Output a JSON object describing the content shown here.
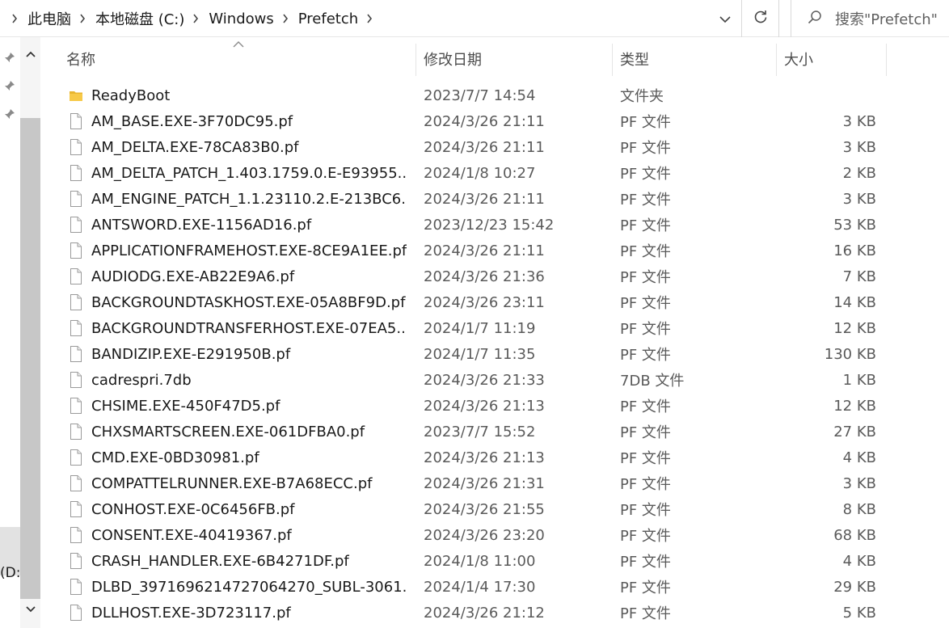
{
  "breadcrumb": {
    "items": [
      "此电脑",
      "本地磁盘 (C:)",
      "Windows",
      "Prefetch"
    ]
  },
  "search": {
    "placeholder": "搜索\"Prefetch\""
  },
  "nav": {
    "drive_label": "(D:)"
  },
  "columns": {
    "name": "名称",
    "date": "修改日期",
    "type": "类型",
    "size": "大小"
  },
  "files": [
    {
      "name": "ReadyBoot",
      "date": "2023/7/7 14:54",
      "type": "文件夹",
      "size": "",
      "icon": "folder-icon"
    },
    {
      "name": "AM_BASE.EXE-3F70DC95.pf",
      "date": "2024/3/26 21:11",
      "type": "PF 文件",
      "size": "3 KB",
      "icon": "file-icon"
    },
    {
      "name": "AM_DELTA.EXE-78CA83B0.pf",
      "date": "2024/3/26 21:11",
      "type": "PF 文件",
      "size": "3 KB",
      "icon": "file-icon"
    },
    {
      "name": "AM_DELTA_PATCH_1.403.1759.0.E-E93955...",
      "date": "2024/1/8 10:27",
      "type": "PF 文件",
      "size": "2 KB",
      "icon": "file-icon"
    },
    {
      "name": "AM_ENGINE_PATCH_1.1.23110.2.E-213BC6...",
      "date": "2024/3/26 21:11",
      "type": "PF 文件",
      "size": "3 KB",
      "icon": "file-icon"
    },
    {
      "name": "ANTSWORD.EXE-1156AD16.pf",
      "date": "2023/12/23 15:42",
      "type": "PF 文件",
      "size": "53 KB",
      "icon": "file-icon"
    },
    {
      "name": "APPLICATIONFRAMEHOST.EXE-8CE9A1EE.pf",
      "date": "2024/3/26 21:11",
      "type": "PF 文件",
      "size": "16 KB",
      "icon": "file-icon"
    },
    {
      "name": "AUDIODG.EXE-AB22E9A6.pf",
      "date": "2024/3/26 21:36",
      "type": "PF 文件",
      "size": "7 KB",
      "icon": "file-icon"
    },
    {
      "name": "BACKGROUNDTASKHOST.EXE-05A8BF9D.pf",
      "date": "2024/3/26 23:11",
      "type": "PF 文件",
      "size": "14 KB",
      "icon": "file-icon"
    },
    {
      "name": "BACKGROUNDTRANSFERHOST.EXE-07EA5...",
      "date": "2024/1/7 11:19",
      "type": "PF 文件",
      "size": "12 KB",
      "icon": "file-icon"
    },
    {
      "name": "BANDIZIP.EXE-E291950B.pf",
      "date": "2024/1/7 11:35",
      "type": "PF 文件",
      "size": "130 KB",
      "icon": "file-icon"
    },
    {
      "name": "cadrespri.7db",
      "date": "2024/3/26 21:33",
      "type": "7DB 文件",
      "size": "1 KB",
      "icon": "file-icon"
    },
    {
      "name": "CHSIME.EXE-450F47D5.pf",
      "date": "2024/3/26 21:13",
      "type": "PF 文件",
      "size": "12 KB",
      "icon": "file-icon"
    },
    {
      "name": "CHXSMARTSCREEN.EXE-061DFBA0.pf",
      "date": "2023/7/7 15:52",
      "type": "PF 文件",
      "size": "27 KB",
      "icon": "file-icon"
    },
    {
      "name": "CMD.EXE-0BD30981.pf",
      "date": "2024/3/26 21:13",
      "type": "PF 文件",
      "size": "4 KB",
      "icon": "file-icon"
    },
    {
      "name": "COMPATTELRUNNER.EXE-B7A68ECC.pf",
      "date": "2024/3/26 21:31",
      "type": "PF 文件",
      "size": "3 KB",
      "icon": "file-icon"
    },
    {
      "name": "CONHOST.EXE-0C6456FB.pf",
      "date": "2024/3/26 21:55",
      "type": "PF 文件",
      "size": "8 KB",
      "icon": "file-icon"
    },
    {
      "name": "CONSENT.EXE-40419367.pf",
      "date": "2024/3/26 23:20",
      "type": "PF 文件",
      "size": "68 KB",
      "icon": "file-icon"
    },
    {
      "name": "CRASH_HANDLER.EXE-6B4271DF.pf",
      "date": "2024/1/8 11:00",
      "type": "PF 文件",
      "size": "4 KB",
      "icon": "file-icon"
    },
    {
      "name": "DLBD_3971696214727064270_SUBL-3061...",
      "date": "2024/1/4 17:30",
      "type": "PF 文件",
      "size": "29 KB",
      "icon": "file-icon"
    },
    {
      "name": "DLLHOST.EXE-3D723117.pf",
      "date": "2024/3/26 21:12",
      "type": "PF 文件",
      "size": "5 KB",
      "icon": "file-icon"
    }
  ]
}
